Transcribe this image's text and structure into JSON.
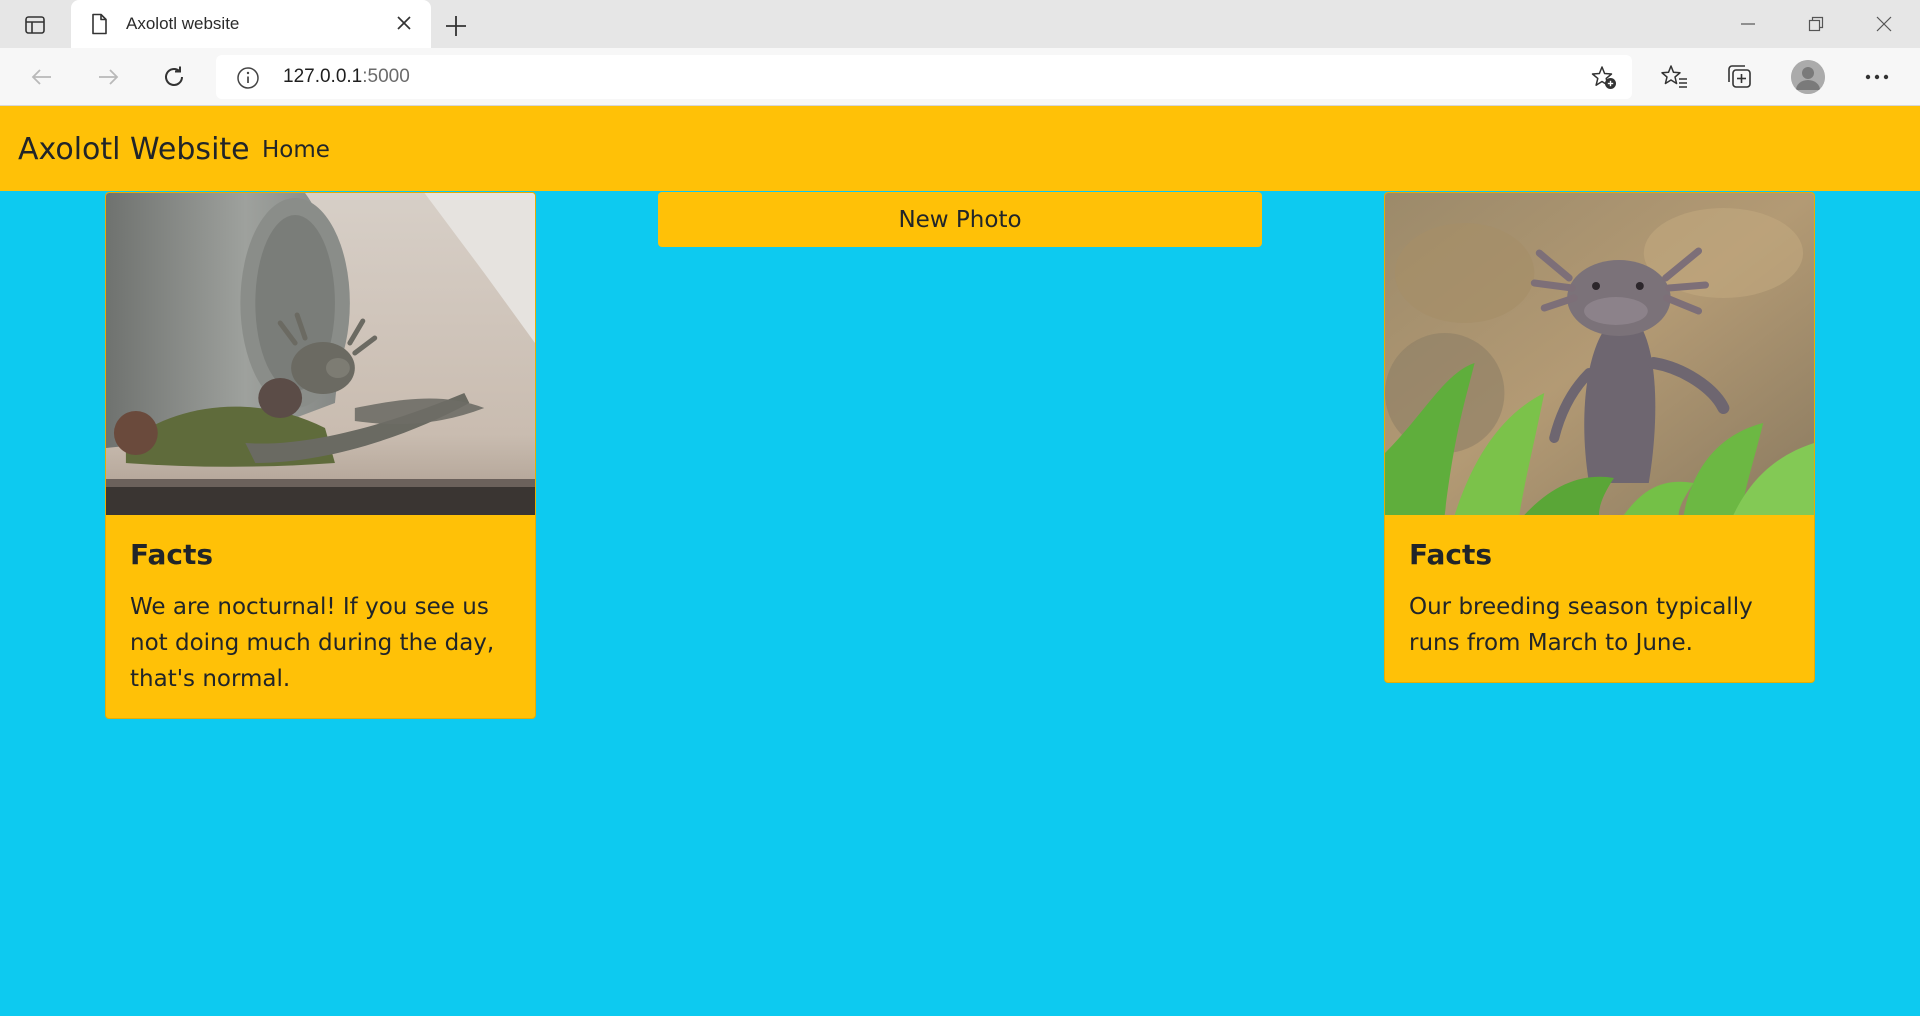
{
  "browser": {
    "tab_title": "Axolotl website",
    "url_host": "127.0.0.1",
    "url_port": ":5000"
  },
  "navbar": {
    "brand": "Axolotl Website",
    "home_link": "Home"
  },
  "new_photo_button": "New Photo",
  "cards": [
    {
      "title": "Facts",
      "text": "We are nocturnal! If you see us not doing much during the day, that's normal."
    },
    {
      "title": "Facts",
      "text": "Our breeding season typically runs from March to June."
    }
  ],
  "colors": {
    "page_background": "#0dcaf0",
    "accent": "#ffc107"
  }
}
